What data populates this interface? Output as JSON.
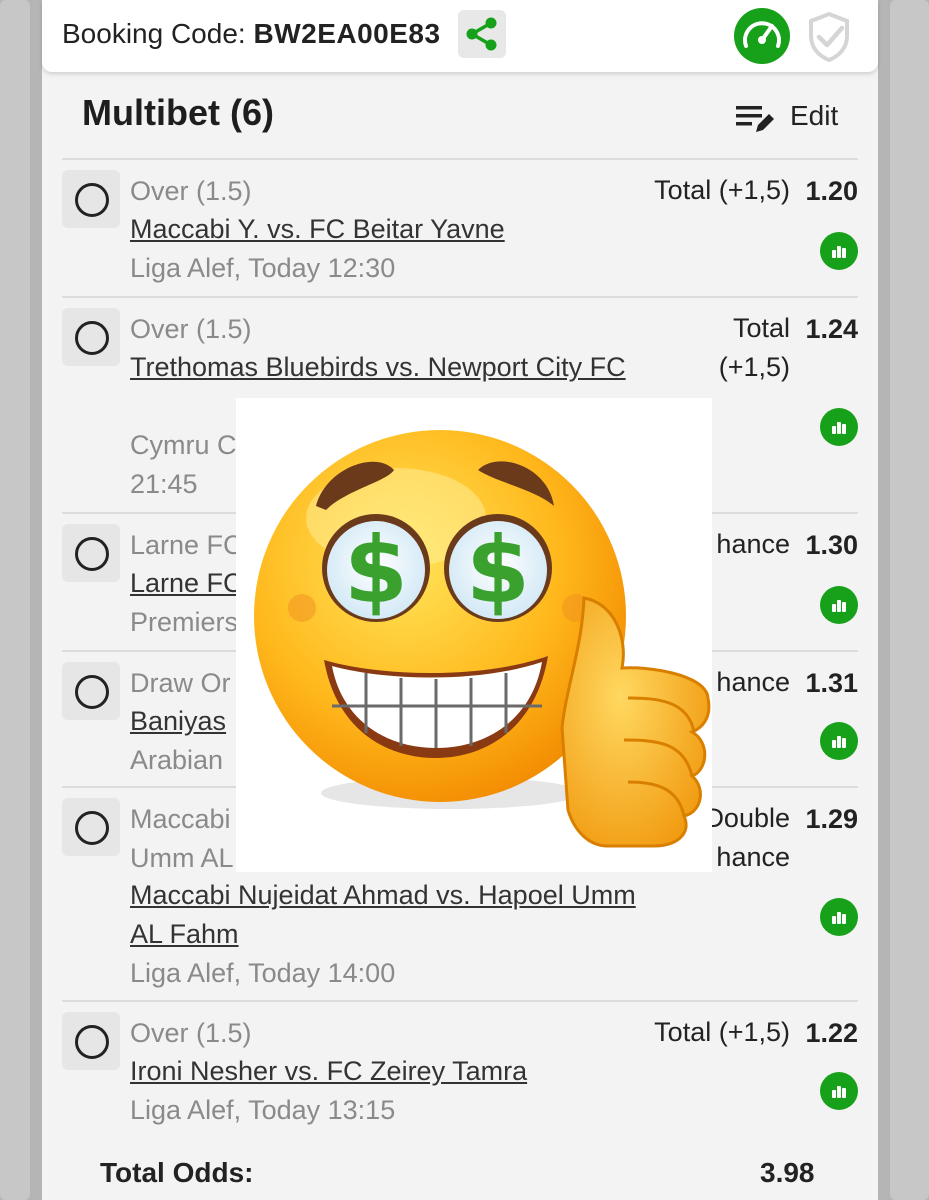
{
  "booking": {
    "label": "Booking Code: ",
    "code": "BW2EA00E83",
    "share_icon": "share-icon",
    "speed_icon": "speedometer-icon",
    "shield_icon": "shield-check-icon"
  },
  "multibet": {
    "title": "Multibet (6)",
    "edit_label": "Edit",
    "edit_icon": "edit-list-icon"
  },
  "bets": [
    {
      "selection": "Over (1.5)",
      "match": "Maccabi Y. vs. FC Beitar Yavne",
      "league": "Liga Alef, Today 12:30",
      "market": "Total (+1,5)",
      "odd": "1.20"
    },
    {
      "selection": "Over (1.5)",
      "match": "Trethomas Bluebirds vs. Newport City FC",
      "league": "Cymru C",
      "time": "21:45",
      "market": "Total (+1,5)",
      "odd": "1.24"
    },
    {
      "selection": "Larne FC",
      "match": "Larne FC",
      "league": "Premiers",
      "market": "hance",
      "odd": "1.30"
    },
    {
      "selection": "Draw Or",
      "match": "Baniyas",
      "league": "Arabian",
      "market": "hance",
      "odd": "1.31"
    },
    {
      "selection": "Maccabi",
      "selection_line2": "Umm AL",
      "match": "Maccabi Nujeidat Ahmad vs. Hapoel Umm AL Fahm",
      "league": "Liga Alef, Today 14:00",
      "market": "Double hance",
      "odd": "1.29"
    },
    {
      "selection": "Over (1.5)",
      "match": "Ironi Nesher vs. FC Zeirey Tamra",
      "league": "Liga Alef, Today 13:15",
      "market": "Total (+1,5)",
      "odd": "1.22"
    }
  ],
  "total": {
    "label": "Total Odds:",
    "value": "3.98"
  },
  "overlay": {
    "icon": "money-eyes-thumbs-up-emoji"
  },
  "colors": {
    "accent_green": "#17a11a",
    "sheet_bg": "#f3f3f3"
  }
}
